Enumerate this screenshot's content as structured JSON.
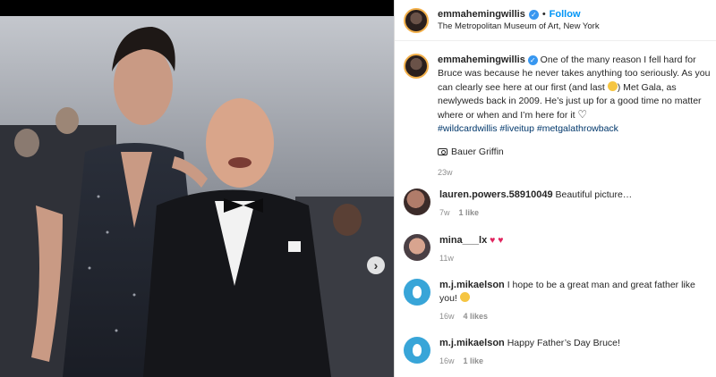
{
  "post": {
    "username": "emmahemingwillis",
    "location": "The Metropolitan Museum of Art, New York",
    "follow_label": "Follow",
    "dot": "•",
    "caption_text_1": "One of the many reason I fell hard for Bruce was because he never takes anything too seriously. As you can clearly see here at our first (and last",
    "caption_text_2": ") Met Gala, as newlyweds back in 2009. He’s just up for a good time no matter where or when and I’m here for it",
    "hashtags": "#wildcardwillis #liveitup #metgalathrowback",
    "photo_credit": "Bauer Griffin",
    "time": "23w",
    "next_icon_glyph": "›"
  },
  "comments": [
    {
      "username": "lauren.powers.58910049",
      "text": "Beautiful picture…",
      "time": "7w",
      "likes": "1 like",
      "avatar": "photo"
    },
    {
      "username": "mina___lx",
      "text": "♥ ♥",
      "time": "11w",
      "likes": "",
      "avatar": "photo"
    },
    {
      "username": "m.j.mikaelson",
      "text": "I hope to be a great man and great father like you!",
      "time": "16w",
      "likes": "4 likes",
      "avatar": "blue-drop"
    },
    {
      "username": "m.j.mikaelson",
      "text": "Happy Father’s Day Bruce!",
      "time": "16w",
      "likes": "1 like",
      "avatar": "blue-drop"
    }
  ],
  "colors": {
    "follow": "#0095f6",
    "hashtag": "#00376b",
    "verified": "#3897f0",
    "heart": "#e0245e"
  }
}
